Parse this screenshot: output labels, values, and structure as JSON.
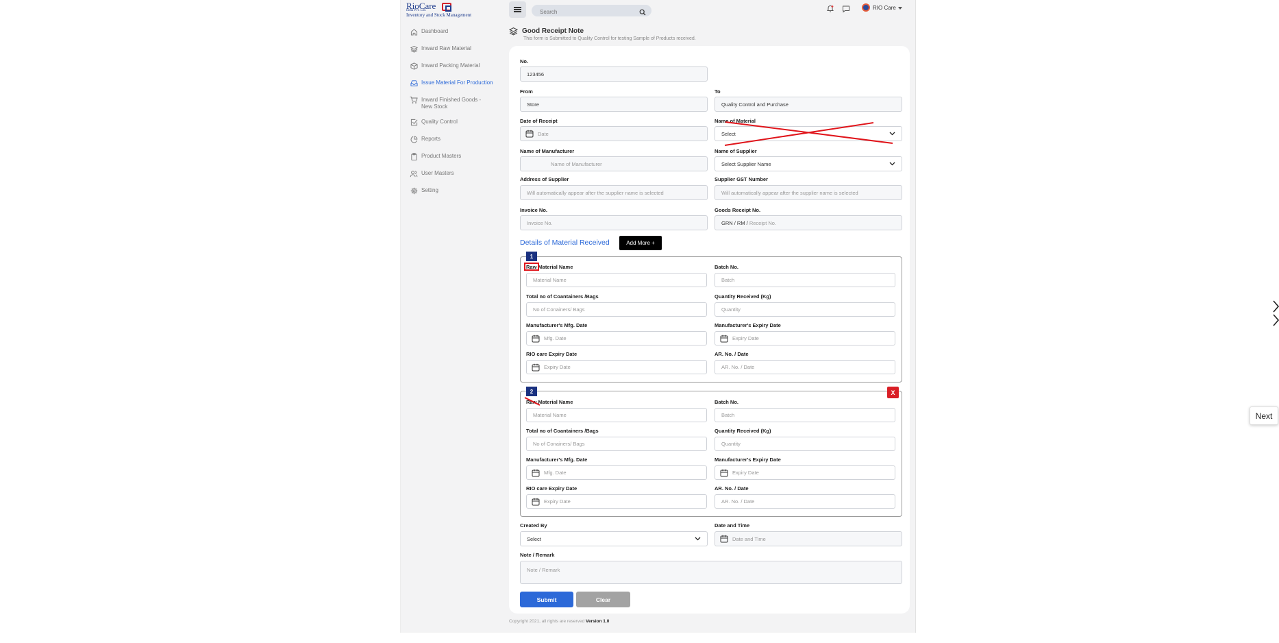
{
  "brand": {
    "name": "RioCare",
    "sub": "India Pvt. Ltd.",
    "tagline": "Inventory and Stock Management",
    "accent": "#2c69d8",
    "brand_color": "#1d3b8c",
    "mark_color": "#d4232b"
  },
  "sidebar": {
    "items": [
      {
        "label": "Dashboard",
        "icon": "home-icon"
      },
      {
        "label": "Inward Raw Material",
        "icon": "layers-icon"
      },
      {
        "label": "Inward Packing Material",
        "icon": "box-icon"
      },
      {
        "label": "Issue Material For Production",
        "icon": "inbox-icon",
        "active": true
      },
      {
        "label": "Inward Finished Goods - New Stock",
        "icon": "cart-icon"
      },
      {
        "label": "Quality Control",
        "icon": "check-square-icon"
      },
      {
        "label": "Reports",
        "icon": "pie-chart-icon"
      },
      {
        "label": "Product Masters",
        "icon": "clipboard-icon"
      },
      {
        "label": "User Masters",
        "icon": "users-icon"
      },
      {
        "label": "Setting",
        "icon": "gear-icon"
      }
    ]
  },
  "topbar": {
    "search_placeholder": "Search",
    "user_name": "RIO Care"
  },
  "page": {
    "title": "Good Receipt Note",
    "subtitle": "This form is Submitted to Quality Control for testing Sample of Products received."
  },
  "form": {
    "no_label": "No.",
    "no_value": "123456",
    "from_label": "From",
    "from_value": "Store",
    "to_label": "To",
    "to_value": "Quality Control and Purchase",
    "date_receipt_label": "Date of Receipt",
    "date_receipt_ph": "Date",
    "material_label": "Name of Material",
    "material_value": "Select",
    "manufacturer_label": "Name of Manufacturer",
    "manufacturer_ph": "Name of Manufacturer",
    "supplier_label": "Name of Supplier",
    "supplier_value": "Select Supplier Name",
    "address_label": "Address of Supplier",
    "address_ph": "Will automatically appear after the supplier name is selected",
    "gst_label": "Supplier GST Number",
    "gst_ph": "Will automatically appear after the supplier name is selected",
    "invoice_label": "Invoice No.",
    "invoice_ph": "Invoice No.",
    "grn_label": "Goods Receipt No.",
    "grn_prefix": "GRN / RM /",
    "grn_ph": "Receipt No.",
    "details_title": "Details of Material Received",
    "add_more": "Add More +",
    "materials": [
      {
        "index": "1",
        "raw_label": "Raw Material Name",
        "raw_ph": "Material Name",
        "batch_label": "Batch No.",
        "batch_ph": "Batch",
        "containers_label": "Total no of Coantainers /Bags",
        "containers_ph": "No of Conainers/ Bags",
        "qty_label": "Quantity Received (Kg)",
        "qty_ph": "Quantity",
        "mfg_label": "Manufacturer's Mfg. Date",
        "mfg_ph": "Mfg. Date",
        "exp_label": "Manufacturer's Expiry Date",
        "exp_ph": "Expiry Date",
        "rio_label": "RIO care Expiry Date",
        "rio_ph": "Expiry Date",
        "ar_label": "AR. No. / Date",
        "ar_ph": "AR. No. / Date"
      },
      {
        "index": "2",
        "remove": "X",
        "raw_label": "Raw Material Name",
        "raw_ph": "Material Name",
        "batch_label": "Batch No.",
        "batch_ph": "Batch",
        "containers_label": "Total no of Coantainers /Bags",
        "containers_ph": "No of Conainers/ Bags",
        "qty_label": "Quantity Received (Kg)",
        "qty_ph": "Quantity",
        "mfg_label": "Manufacturer's Mfg. Date",
        "mfg_ph": "Mfg. Date",
        "exp_label": "Manufacturer's Expiry Date",
        "exp_ph": "Expiry Date",
        "rio_label": "RIO care Expiry Date",
        "rio_ph": "Expiry Date",
        "ar_label": "AR. No. / Date",
        "ar_ph": "AR. No. / Date"
      }
    ],
    "created_by_label": "Created By",
    "created_by_value": "Select",
    "datetime_label": "Date and Time",
    "datetime_ph": "Date and Time",
    "remark_label": "Note / Remark",
    "remark_ph": "Note / Remark",
    "submit": "Submit",
    "clear": "Clear"
  },
  "footer": {
    "copyright": "Copyright 2021, all rights are reserved",
    "version": "Version 1.0"
  },
  "next_button": "Next"
}
